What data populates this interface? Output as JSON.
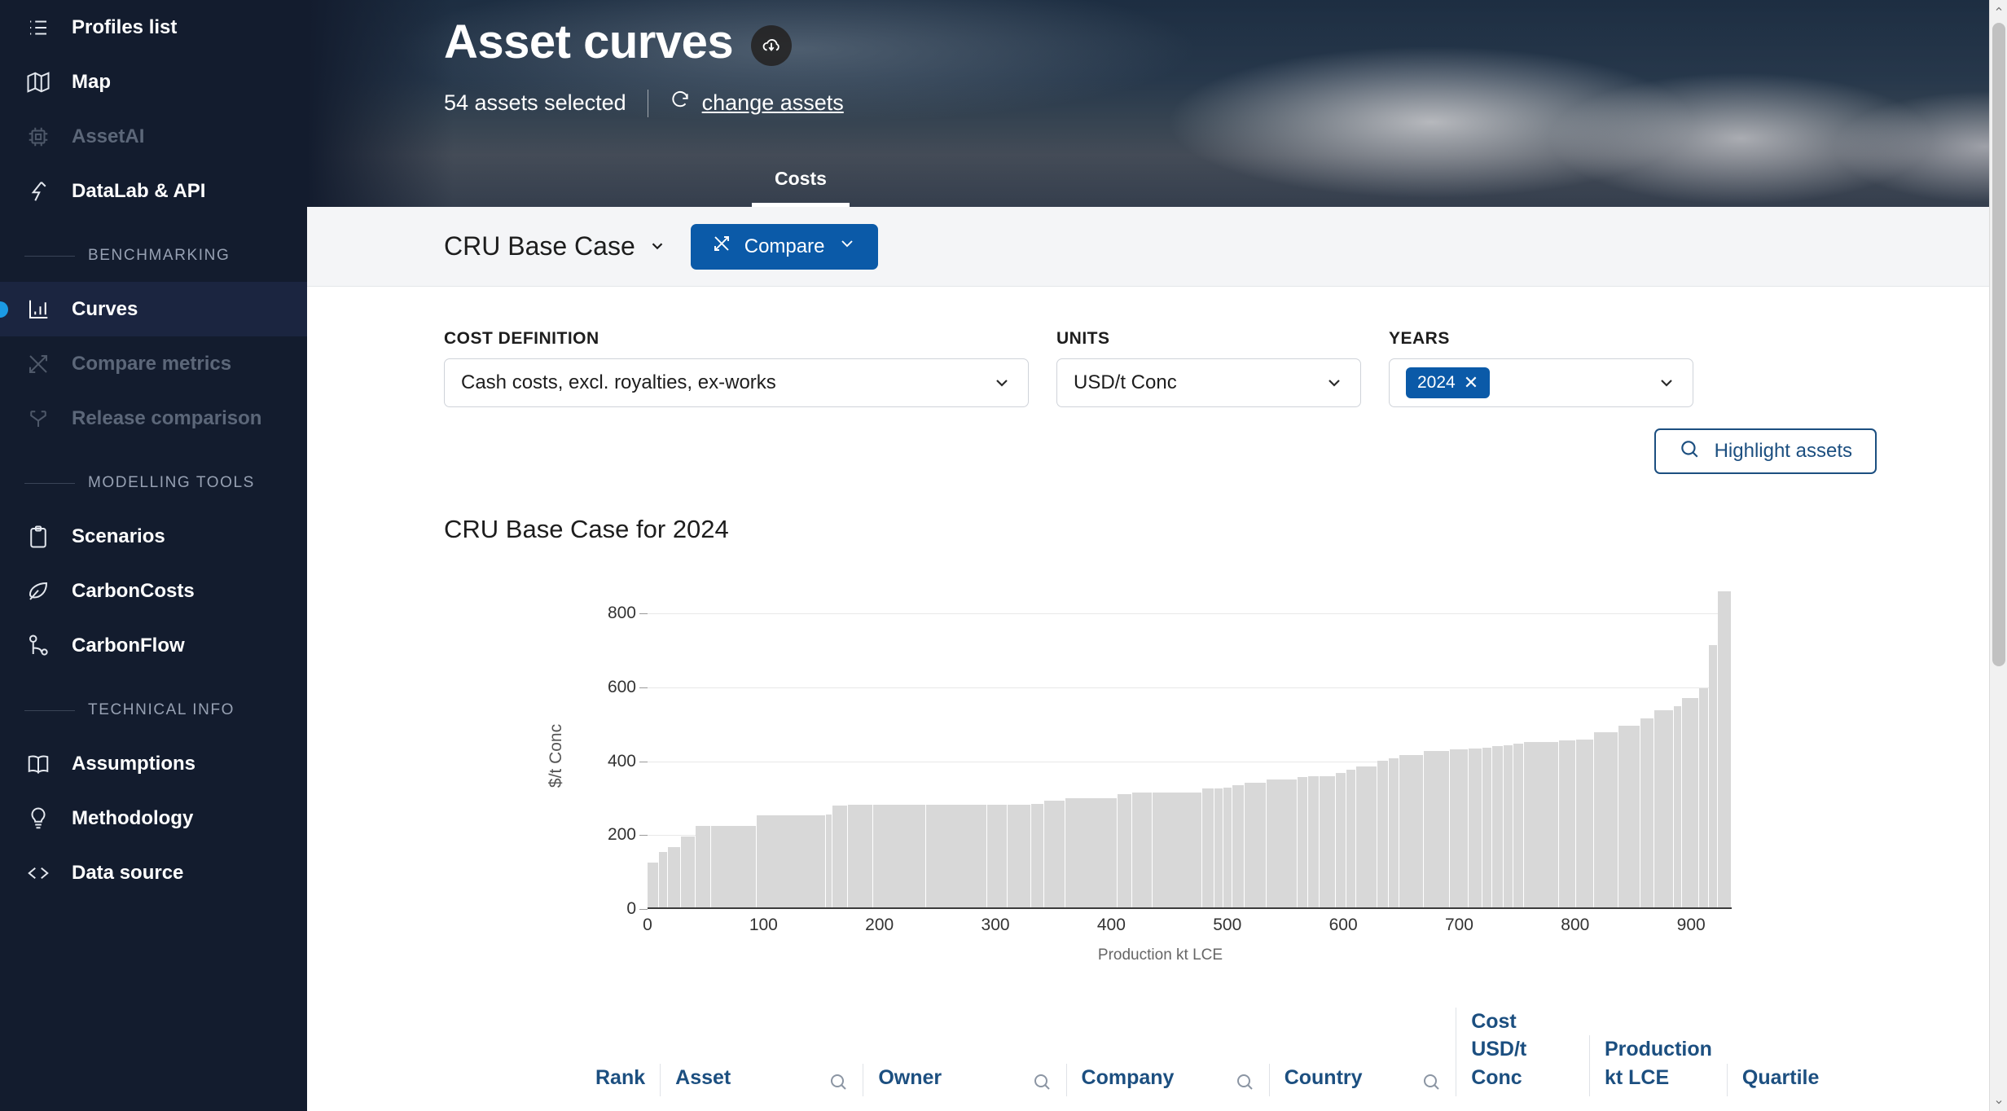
{
  "sidebar": {
    "items": [
      {
        "label": "Profiles list",
        "icon": "list-icon",
        "state": "normal"
      },
      {
        "label": "Map",
        "icon": "map-icon",
        "state": "normal"
      },
      {
        "label": "AssetAI",
        "icon": "chip-icon",
        "state": "disabled"
      },
      {
        "label": "DataLab & API",
        "icon": "bolt-icon",
        "state": "normal"
      }
    ],
    "sections": [
      {
        "title": "BENCHMARKING",
        "items": [
          {
            "label": "Curves",
            "icon": "bar-chart-icon",
            "state": "active"
          },
          {
            "label": "Compare metrics",
            "icon": "shuffle-icon",
            "state": "disabled"
          },
          {
            "label": "Release comparison",
            "icon": "branch-icon",
            "state": "disabled"
          }
        ]
      },
      {
        "title": "MODELLING TOOLS",
        "items": [
          {
            "label": "Scenarios",
            "icon": "clipboard-icon",
            "state": "normal"
          },
          {
            "label": "CarbonCosts",
            "icon": "leaf-icon",
            "state": "normal"
          },
          {
            "label": "CarbonFlow",
            "icon": "flow-icon",
            "state": "normal"
          }
        ]
      },
      {
        "title": "TECHNICAL INFO",
        "items": [
          {
            "label": "Assumptions",
            "icon": "book-icon",
            "state": "normal"
          },
          {
            "label": "Methodology",
            "icon": "lightbulb-icon",
            "state": "normal"
          },
          {
            "label": "Data source",
            "icon": "code-icon",
            "state": "normal"
          }
        ]
      }
    ]
  },
  "header": {
    "title": "Asset curves",
    "download_icon": "download-cloud-icon",
    "assets_selected": "54 assets selected",
    "change_assets": "change assets",
    "change_icon": "refresh-icon",
    "tabs": [
      {
        "label": "Costs",
        "active": true
      }
    ]
  },
  "toolbar": {
    "case_label": "CRU Base Case",
    "compare_label": "Compare",
    "compare_icon": "shuffle-icon",
    "accent_color": "#0b5aa8"
  },
  "filters": {
    "cost_definition": {
      "label": "COST DEFINITION",
      "value": "Cash costs, excl. royalties, ex-works"
    },
    "units": {
      "label": "UNITS",
      "value": "USD/t Conc"
    },
    "years": {
      "label": "YEARS",
      "chips": [
        "2024"
      ]
    },
    "highlight_button": {
      "label": "Highlight assets",
      "icon": "search-icon"
    }
  },
  "chart_data": {
    "type": "bar",
    "title": "CRU Base Case for 2024",
    "xlabel": "Production kt LCE",
    "ylabel": "$/t Conc",
    "xlim": [
      0,
      935
    ],
    "ylim": [
      0,
      900
    ],
    "yticks": [
      0,
      200,
      400,
      600,
      800
    ],
    "xticks": [
      0,
      100,
      200,
      300,
      400,
      500,
      600,
      700,
      800,
      900
    ],
    "grid": true,
    "legend": "none",
    "bar_color": "#d8d8d8",
    "x_widths": [
      11,
      9,
      13,
      14,
      16,
      47,
      72,
      6,
      15,
      26,
      55,
      63,
      21,
      24,
      13,
      21,
      54,
      15,
      20,
      52,
      12,
      8,
      9,
      12,
      22,
      32,
      10,
      11,
      17,
      10,
      9,
      22,
      11,
      10,
      25,
      27,
      19,
      13,
      10,
      11,
      9,
      11,
      36,
      17,
      18,
      25,
      22,
      14,
      19,
      8,
      17,
      10,
      8,
      14
    ],
    "values": [
      122,
      150,
      163,
      193,
      220,
      221,
      249,
      252,
      276,
      277,
      277,
      277,
      277,
      277,
      281,
      290,
      296,
      307,
      310,
      311,
      321,
      322,
      325,
      332,
      337,
      346,
      353,
      355,
      356,
      363,
      372,
      381,
      397,
      404,
      412,
      423,
      428,
      431,
      432,
      437,
      438,
      443,
      448,
      452,
      455,
      474,
      492,
      511,
      533,
      545,
      568,
      594,
      711,
      857
    ]
  },
  "table": {
    "columns": [
      {
        "label": "Rank",
        "search": false
      },
      {
        "label": "Asset",
        "search": true
      },
      {
        "label": "Owner",
        "search": true
      },
      {
        "label": "Company",
        "search": true
      },
      {
        "label": "Country",
        "search": true
      },
      {
        "label": "Cost",
        "sublabel": "USD/t Conc",
        "search": false
      },
      {
        "label": "Production",
        "sublabel": "kt LCE",
        "search": false
      },
      {
        "label": "Quartile",
        "search": false
      }
    ],
    "search_icon": "search-icon",
    "header_color": "#1c4f80"
  },
  "scrollbar": {
    "up_icon": "chevron-up-icon",
    "down_icon": "chevron-down-icon"
  }
}
